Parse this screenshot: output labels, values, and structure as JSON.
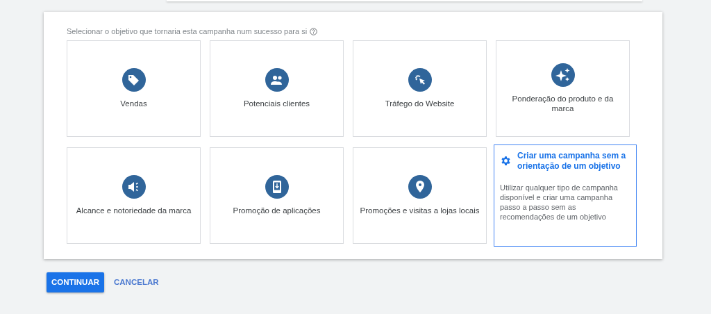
{
  "heading": "Selecionar o objetivo que tornaria esta campanha num sucesso para si",
  "help_icon": true,
  "objectives": [
    {
      "kind": "objective",
      "label": "Vendas",
      "selected": false
    },
    {
      "kind": "objective",
      "label": "Potenciais clientes",
      "selected": false
    },
    {
      "kind": "objective",
      "label": "Tráfego do Website",
      "selected": false
    },
    {
      "kind": "objective",
      "label": "Ponderação do produto e da marca",
      "selected": false
    },
    {
      "kind": "objective",
      "label": "Alcance e notoriedade da marca",
      "selected": false
    },
    {
      "kind": "objective",
      "label": "Promoção de aplicações",
      "selected": false
    },
    {
      "kind": "objective",
      "label": "Promoções e visitas a lojas locais",
      "selected": false
    },
    {
      "kind": "custom",
      "label": "Criar uma campanha sem a orientação de um objetivo",
      "description": "Utilizar qualquer tipo de campanha disponível e criar uma campanha passo a passo sem as recomendações de um objetivo",
      "selected": true
    }
  ],
  "buttons": [
    {
      "kind": "primary",
      "label": "CONTINUAR"
    },
    {
      "kind": "text",
      "label": "CANCELAR"
    }
  ]
}
